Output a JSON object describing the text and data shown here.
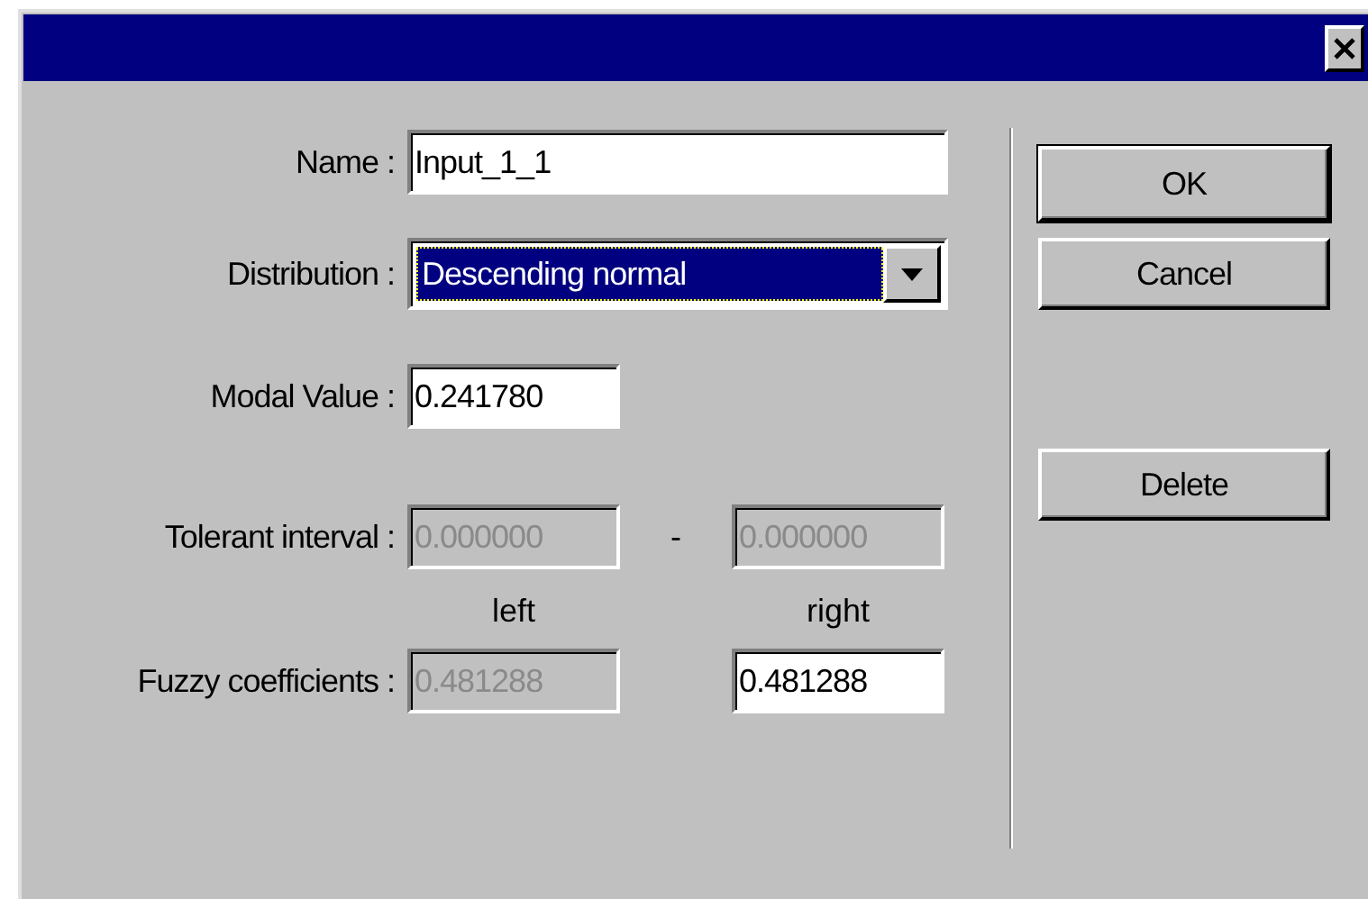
{
  "name": {
    "label": "Name :",
    "value": "Input_1_1",
    "disabled": false
  },
  "distribution": {
    "label": "Distribution :",
    "value": "Descending normal",
    "highlighted": true
  },
  "modal_value": {
    "label": "Modal Value :",
    "value": "0.241780",
    "disabled": false
  },
  "tolerant_interval": {
    "label": "Tolerant interval :",
    "separator": "-",
    "left": {
      "value": "0.000000",
      "disabled": true
    },
    "right": {
      "value": "0.000000",
      "disabled": true
    }
  },
  "column_labels": [
    "left",
    "right"
  ],
  "fuzzy_coefficients": {
    "label": "Fuzzy coefficients :",
    "left": {
      "value": "0.481288",
      "disabled": true
    },
    "right": {
      "value": "0.481288",
      "disabled": false
    }
  },
  "buttons": [
    {
      "label": "OK",
      "default": true
    },
    {
      "label": "Cancel",
      "default": false
    },
    {
      "label": "Delete",
      "default": false
    }
  ]
}
